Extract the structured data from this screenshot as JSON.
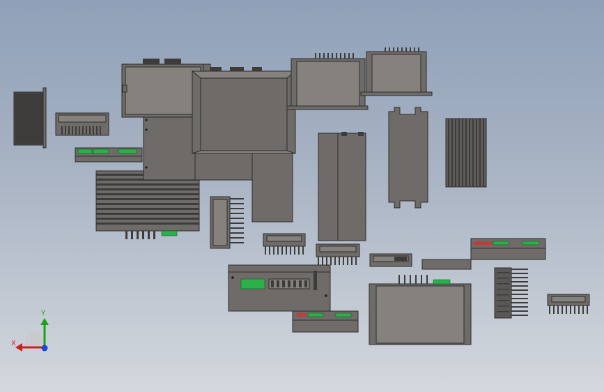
{
  "colors": {
    "body": "#6e6b68",
    "body_light": "#85817d",
    "edge": "#2d2c2b",
    "fin": "#3d3c3b",
    "terminal": "#2bb14a",
    "terminal_red": "#c23b3b",
    "axis_x": "#cc2020",
    "axis_y": "#1aa31a",
    "axis_z": "#2046d6"
  },
  "triad": {
    "x_label": "X",
    "y_label": "Y",
    "x_icon": "x-axis-arrow-icon",
    "y_icon": "y-axis-arrow-icon",
    "z_icon": "z-axis-dot-icon"
  },
  "parts": [
    {
      "name": "black-driver-side"
    },
    {
      "name": "finned-small-driver"
    },
    {
      "name": "terminal-strip-driver"
    },
    {
      "name": "large-heatsink-driver"
    },
    {
      "name": "db-connector-driver"
    },
    {
      "name": "enclosure-box-driver"
    },
    {
      "name": "flat-panel-driver"
    },
    {
      "name": "connector-top-driver-a"
    },
    {
      "name": "connector-top-driver-b"
    },
    {
      "name": "slotted-plate-pair"
    },
    {
      "name": "slotted-plate-single"
    },
    {
      "name": "vertical-fin-heatsink"
    },
    {
      "name": "side-fin-driver"
    },
    {
      "name": "small-finned-block-a"
    },
    {
      "name": "small-finned-block-b"
    },
    {
      "name": "terminal-panel-driver"
    },
    {
      "name": "tiny-connector-module"
    },
    {
      "name": "flat-bar-module"
    },
    {
      "name": "side-terminal-driver"
    },
    {
      "name": "heatsink-block-right"
    },
    {
      "name": "comb-fin-module"
    },
    {
      "name": "large-base-driver"
    },
    {
      "name": "low-terminal-driver"
    }
  ]
}
